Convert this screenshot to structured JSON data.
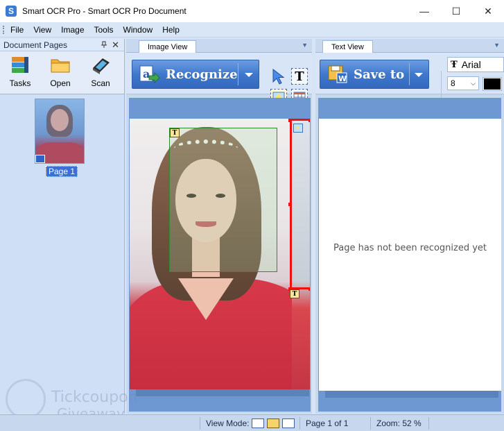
{
  "window": {
    "title": "Smart OCR Pro - Smart OCR Pro Document",
    "minimize": "—",
    "maximize": "☐",
    "close": "✕"
  },
  "menu": [
    "File",
    "View",
    "Image",
    "Tools",
    "Window",
    "Help"
  ],
  "left_panel": {
    "title": "Document Pages",
    "pin": "📌",
    "close": "✕",
    "tools": [
      {
        "label": "Tasks",
        "icon": "tasks-icon"
      },
      {
        "label": "Open",
        "icon": "folder-icon"
      },
      {
        "label": "Scan",
        "icon": "scanner-icon"
      }
    ],
    "pages": [
      {
        "label": "Page 1"
      }
    ]
  },
  "image_view": {
    "tab": "Image View",
    "recognize_label": "Recognize",
    "tools": [
      "pointer-icon",
      "text-zone-icon",
      "picture-zone-icon",
      "table-zone-icon"
    ],
    "text_tool_glyph": "T",
    "zone_tag_glyph": "T"
  },
  "text_view": {
    "tab": "Text View",
    "save_label": "Save to",
    "font": "Arial",
    "font_glyph": "Ŧ",
    "font_size": "8",
    "font_color": "#000000",
    "message": "Page has not been recognized yet"
  },
  "status": {
    "view_mode_label": "View Mode:",
    "page_info": "Page 1 of 1",
    "zoom": "Zoom: 52 %"
  },
  "watermark": {
    "line1": "Tickcoupon",
    "line2": "Giveaway"
  },
  "colors": {
    "accent": "#3f78cc",
    "zone_text": "#2e8b2e",
    "zone_selected": "#ee1111"
  }
}
